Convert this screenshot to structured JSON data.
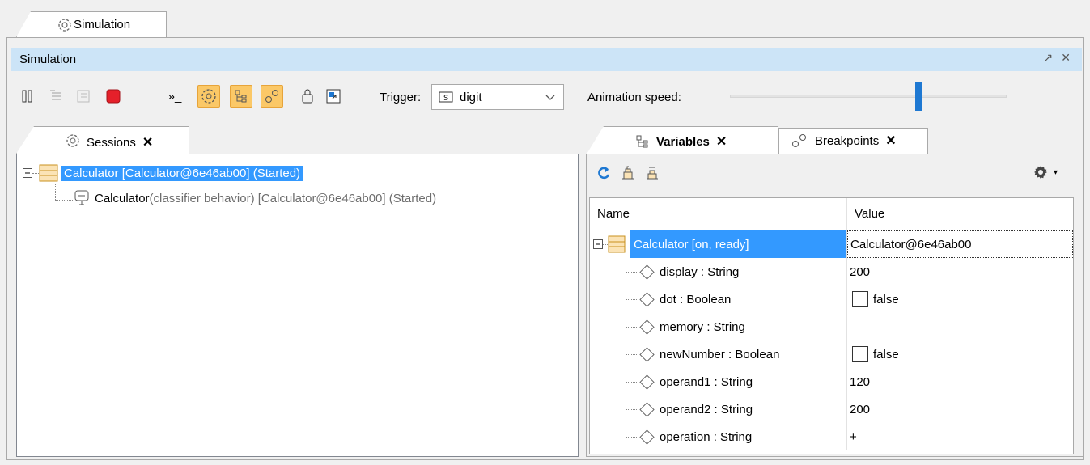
{
  "window": {
    "top_tab_label": "Simulation",
    "title": "Simulation",
    "controls": [
      "restore-icon",
      "close-icon"
    ]
  },
  "toolbar": {
    "trigger_label": "Trigger:",
    "trigger_value": "digit",
    "animation_speed_label": "Animation speed:",
    "animation_speed": 0.68
  },
  "sessions": {
    "tab_label": "Sessions",
    "tree": [
      {
        "label": "Calculator [Calculator@6e46ab00] (Started)",
        "selected": true
      },
      {
        "label_bold": "Calculator",
        "label_rest": "(classifier behavior) [Calculator@6e46ab00] (Started)"
      }
    ]
  },
  "variables": {
    "tab_label": "Variables",
    "breakpoints_tab_label": "Breakpoints",
    "columns": [
      "Name",
      "Value"
    ],
    "root": {
      "name": "Calculator [on, ready]",
      "value": "Calculator@6e46ab00"
    },
    "rows": [
      {
        "name": "display : String",
        "value": "200",
        "checkbox": false
      },
      {
        "name": "dot : Boolean",
        "value": "false",
        "checkbox": true
      },
      {
        "name": "memory : String",
        "value": "",
        "checkbox": false
      },
      {
        "name": "newNumber : Boolean",
        "value": "false",
        "checkbox": true
      },
      {
        "name": "operand1 : String",
        "value": "120",
        "checkbox": false
      },
      {
        "name": "operand2 : String",
        "value": "200",
        "checkbox": false
      },
      {
        "name": "operation : String",
        "value": "+",
        "checkbox": false
      }
    ]
  },
  "colors": {
    "selection": "#3399ff",
    "active_button": "#fbc867",
    "title_bar": "#cce4f7",
    "slider_thumb": "#1e78d2",
    "stop": "#e5202a"
  }
}
